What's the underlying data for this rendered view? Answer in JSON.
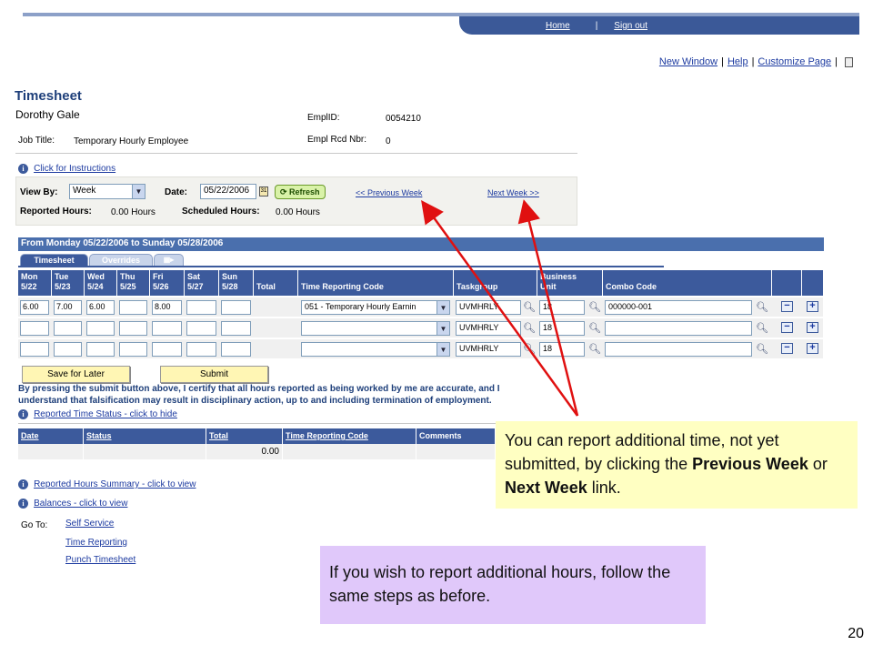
{
  "nav": {
    "home": "Home",
    "sep": "|",
    "sign_out": "Sign out"
  },
  "util": {
    "new_window": "New Window",
    "help": "Help",
    "customize": "Customize Page",
    "sep": "|"
  },
  "page": {
    "title": "Timesheet",
    "employee_name": "Dorothy Gale"
  },
  "info": {
    "emplid_label": "EmplID:",
    "emplid": "0054210",
    "job_title_label": "Job Title:",
    "job_title": "Temporary Hourly Employee",
    "rcd_label": "Empl Rcd Nbr:",
    "rcd": "0"
  },
  "instructions_link": "Click for Instructions",
  "controls": {
    "view_by_label": "View By:",
    "view_by": "Week",
    "date_label": "Date:",
    "date": "05/22/2006",
    "refresh": "Refresh",
    "prev_week": "<< Previous Week",
    "next_week": "Next Week >>",
    "reported_label": "Reported Hours:",
    "reported": "0.00 Hours",
    "scheduled_label": "Scheduled Hours:",
    "scheduled": "0.00 Hours"
  },
  "period": "From Monday 05/22/2006 to Sunday 05/28/2006",
  "tabs": {
    "timesheet": "Timesheet",
    "overrides": "Overrides"
  },
  "columns": {
    "mon": [
      "Mon",
      "5/22"
    ],
    "tue": [
      "Tue",
      "5/23"
    ],
    "wed": [
      "Wed",
      "5/24"
    ],
    "thu": [
      "Thu",
      "5/25"
    ],
    "fri": [
      "Fri",
      "5/26"
    ],
    "sat": [
      "Sat",
      "5/27"
    ],
    "sun": [
      "Sun",
      "5/28"
    ],
    "total": "Total",
    "trc": "Time Reporting Code",
    "taskgroup": "Taskgroup",
    "bu": [
      "Business",
      "Unit"
    ],
    "combo": "Combo Code"
  },
  "rows": [
    {
      "mon": "6.00",
      "tue": "7.00",
      "wed": "6.00",
      "thu": "",
      "fri": "8.00",
      "sat": "",
      "sun": "",
      "trc": "051 - Temporary Hourly Earnin",
      "taskgroup": "UVMHRLY",
      "bu": "18",
      "combo": "000000-001"
    },
    {
      "mon": "",
      "tue": "",
      "wed": "",
      "thu": "",
      "fri": "",
      "sat": "",
      "sun": "",
      "trc": "",
      "taskgroup": "UVMHRLY",
      "bu": "18",
      "combo": ""
    },
    {
      "mon": "",
      "tue": "",
      "wed": "",
      "thu": "",
      "fri": "",
      "sat": "",
      "sun": "",
      "trc": "",
      "taskgroup": "UVMHRLY",
      "bu": "18",
      "combo": ""
    }
  ],
  "buttons": {
    "save_later": "Save for Later",
    "submit": "Submit"
  },
  "certification": "By pressing the submit button above, I certify that all hours reported as being worked by me are accurate, and I understand that falsification may result in disciplinary action, up to and including termination of employment.",
  "status_link": "Reported Time Status - click to hide",
  "status_grid": {
    "headers": [
      "Date",
      "Status",
      "Total",
      "Time Reporting Code",
      "Comments"
    ],
    "total": "0.00"
  },
  "summary_link": "Reported Hours Summary - click to view",
  "balances_link": "Balances - click to view",
  "goto": {
    "label": "Go To:",
    "links": [
      "Self Service",
      "Time Reporting",
      "Punch Timesheet"
    ]
  },
  "callout1": {
    "part1": "You can report additional time, not yet submitted, by clicking the ",
    "prev": "Previous Week",
    "or": " or ",
    "next": "Next Week",
    "end": " link."
  },
  "callout2": "If you wish to report additional hours, follow the same steps as before.",
  "page_number": "20",
  "colors": {
    "header_blue": "#3c5a9c",
    "callout_yellow": "#ffffc2",
    "callout_purple": "#e0c8fa",
    "arrow_red": "#e01010"
  }
}
